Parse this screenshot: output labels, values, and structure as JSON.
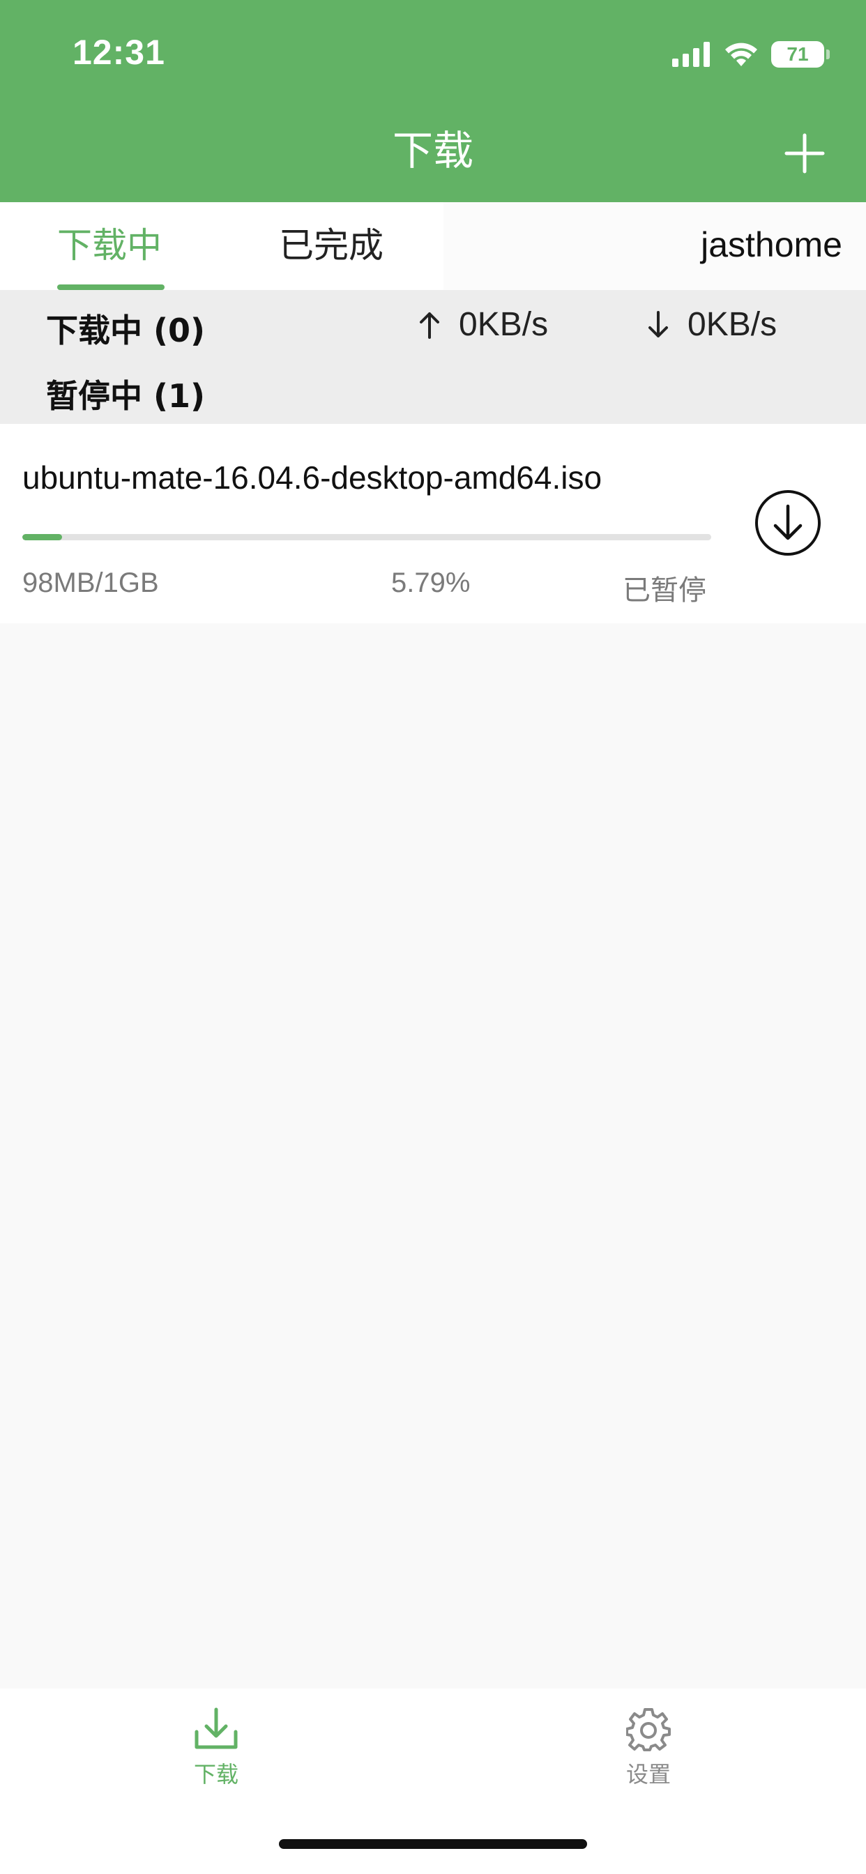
{
  "status_bar": {
    "time": "12:31",
    "battery": "71"
  },
  "nav": {
    "title": "下载"
  },
  "tabs": [
    {
      "label": "下载中",
      "active": true
    },
    {
      "label": "已完成",
      "active": false
    }
  ],
  "host": "jasthome",
  "summary": {
    "downloading_label": "下载中 (0)",
    "paused_label": "暂停中 (1)",
    "upload_speed": "0KB/s",
    "download_speed": "0KB/s"
  },
  "downloads": [
    {
      "name": "ubuntu-mate-16.04.6-desktop-amd64.iso",
      "size": "98MB/1GB",
      "percent_text": "5.79%",
      "progress": 0.0579,
      "status": "已暂停"
    }
  ],
  "bottom_tabs": [
    {
      "label": "下载",
      "icon": "download-tray-icon",
      "active": true
    },
    {
      "label": "设置",
      "icon": "gear-icon",
      "active": false
    }
  ],
  "colors": {
    "accent": "#62b265",
    "inactive": "#8a8a8a"
  }
}
